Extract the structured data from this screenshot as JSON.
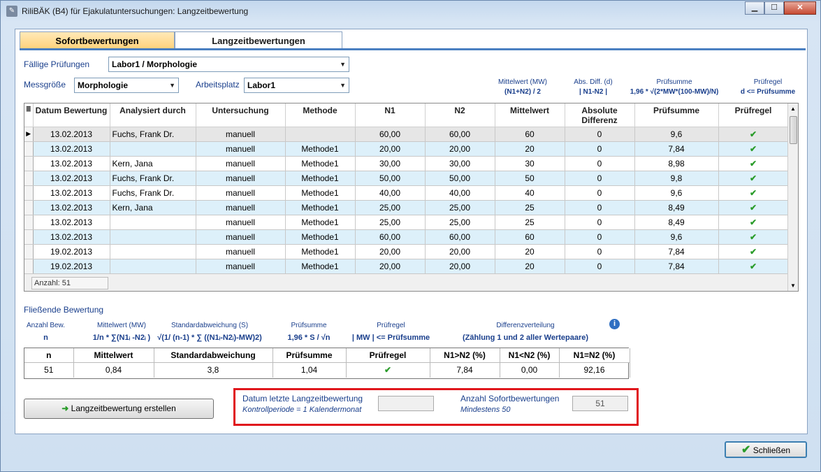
{
  "window": {
    "title": "RiliBÄK (B4) für Ejakulatuntersuchungen: Langzeitbewertung",
    "minimize": "▁",
    "maximize": "☐",
    "close": "✕",
    "app_icon": "app-icon"
  },
  "tabs": [
    "Sofortbewertungen",
    "Langzeitbewertungen"
  ],
  "filters": {
    "faellige_label": "Fällige Prüfungen",
    "faellige_value": "Labor1 / Morphologie",
    "messgroesse_label": "Messgröße",
    "messgroesse_value": "Morphologie",
    "arbeitsplatz_label": "Arbeitsplatz",
    "arbeitsplatz_value": "Labor1"
  },
  "formula_headers": [
    {
      "title": "Mittelwert (MW)",
      "formula": "(N1+N2) / 2"
    },
    {
      "title": "Abs. Diff. (d)",
      "formula": "| N1-N2 |"
    },
    {
      "title": "Prüfsumme",
      "formula": "1,96 * √(2*MW*(100-MW)/N)"
    },
    {
      "title": "Prüfregel",
      "formula": "d <= Prüfsumme"
    }
  ],
  "table": {
    "columns": [
      "Datum Bewertung",
      "Analysiert durch",
      "Untersuchung",
      "Methode",
      "N1",
      "N2",
      "Mittelwert",
      "Absolute Differenz",
      "Prüfsumme",
      "Prüfregel"
    ],
    "rows": [
      [
        "13.02.2013",
        "Fuchs, Frank Dr.",
        "manuell",
        "",
        "60,00",
        "60,00",
        "60",
        "0",
        "9,6",
        "✔"
      ],
      [
        "13.02.2013",
        "",
        "manuell",
        "Methode1",
        "20,00",
        "20,00",
        "20",
        "0",
        "7,84",
        "✔"
      ],
      [
        "13.02.2013",
        "Kern, Jana",
        "manuell",
        "Methode1",
        "30,00",
        "30,00",
        "30",
        "0",
        "8,98",
        "✔"
      ],
      [
        "13.02.2013",
        "Fuchs, Frank Dr.",
        "manuell",
        "Methode1",
        "50,00",
        "50,00",
        "50",
        "0",
        "9,8",
        "✔"
      ],
      [
        "13.02.2013",
        "Fuchs, Frank Dr.",
        "manuell",
        "Methode1",
        "40,00",
        "40,00",
        "40",
        "0",
        "9,6",
        "✔"
      ],
      [
        "13.02.2013",
        "Kern, Jana",
        "manuell",
        "Methode1",
        "25,00",
        "25,00",
        "25",
        "0",
        "8,49",
        "✔"
      ],
      [
        "13.02.2013",
        "",
        "manuell",
        "Methode1",
        "25,00",
        "25,00",
        "25",
        "0",
        "8,49",
        "✔"
      ],
      [
        "13.02.2013",
        "",
        "manuell",
        "Methode1",
        "60,00",
        "60,00",
        "60",
        "0",
        "9,6",
        "✔"
      ],
      [
        "19.02.2013",
        "",
        "manuell",
        "Methode1",
        "20,00",
        "20,00",
        "20",
        "0",
        "7,84",
        "✔"
      ],
      [
        "19.02.2013",
        "",
        "manuell",
        "Methode1",
        "20,00",
        "20,00",
        "20",
        "0",
        "7,84",
        "✔"
      ]
    ],
    "count_label": "Anzahl: 51"
  },
  "fliessend": {
    "title": "Fließende Bewertung",
    "formulas": [
      {
        "title": "Anzahl Bew.",
        "formula": "n"
      },
      {
        "title": "Mittelwert (MW)",
        "formula": "1/n * ∑(N1ᵢ -N2ᵢ )"
      },
      {
        "title": "Standardabweichung (S)",
        "formula": "√(1/ (n-1) * ∑ ((N1ᵢ-N2ᵢ)-MW)2)"
      },
      {
        "title": "Prüfsumme",
        "formula": "1,96 * S / √n"
      },
      {
        "title": "Prüfregel",
        "formula": "| MW | <= Prüfsumme"
      },
      {
        "title": "Differenzverteilung",
        "formula": "(Zählung 1 und 2 aller Wertepaare)"
      }
    ],
    "columns": [
      "n",
      "Mittelwert",
      "Standardabweichung",
      "Prüfsumme",
      "Prüfregel",
      "N1>N2 (%)",
      "N1<N2 (%)",
      "N1=N2 (%)"
    ],
    "values": [
      "51",
      "0,84",
      "3,8",
      "1,04",
      "✔",
      "7,84",
      "0,00",
      "92,16"
    ]
  },
  "actions": {
    "create_button": "Langzeitbewertung erstellen",
    "close_button": "Schließen"
  },
  "info_box": {
    "datum_label": "Datum letzte Langzeitbewertung",
    "datum_note": "Kontrollperiode = 1 Kalendermonat",
    "datum_value": "",
    "anzahl_label": "Anzahl Sofortbewertungen",
    "anzahl_note": "Mindestens 50",
    "anzahl_value": "51"
  }
}
